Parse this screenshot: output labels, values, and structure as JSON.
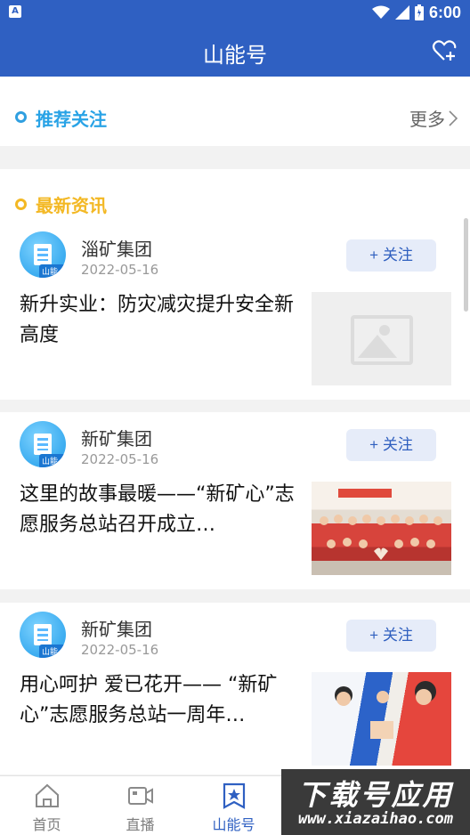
{
  "status_bar": {
    "time": "6:00",
    "app_badge": "A"
  },
  "header": {
    "title": "山能号"
  },
  "recommend": {
    "label": "推荐关注",
    "more": "更多"
  },
  "news": {
    "label": "最新资讯",
    "items": [
      {
        "org": "淄矿集团",
        "badge": "山能号",
        "date": "2022-05-16",
        "follow": "+ 关注",
        "title": "新升实业：防灾减灾提升安全新高度",
        "thumbnail": "placeholder-image"
      },
      {
        "org": "新矿集团",
        "badge": "山能号",
        "date": "2022-05-16",
        "follow": "+ 关注",
        "title": "这里的故事最暖——“新矿心”志愿服务总站召开成立…",
        "thumbnail": "group-photo"
      },
      {
        "org": "新矿集团",
        "badge": "山能号",
        "date": "2022-05-16",
        "follow": "+ 关注",
        "title": "用心呵护 爱已花开—— “新矿心”志愿服务总站一周年…",
        "thumbnail": "volunteer-photo"
      }
    ]
  },
  "bottom_nav": {
    "items": [
      {
        "label": "首页",
        "icon": "home-icon"
      },
      {
        "label": "直播",
        "icon": "video-camera-icon"
      },
      {
        "label": "山能号",
        "icon": "star-bookmark-icon",
        "active": true
      }
    ]
  },
  "watermark": {
    "title": "下载号应用",
    "url": "www.xiazaihao.com"
  },
  "colors": {
    "primary": "#2f60c2",
    "recommend_accent": "#29a3e6",
    "news_accent": "#f3b824"
  }
}
